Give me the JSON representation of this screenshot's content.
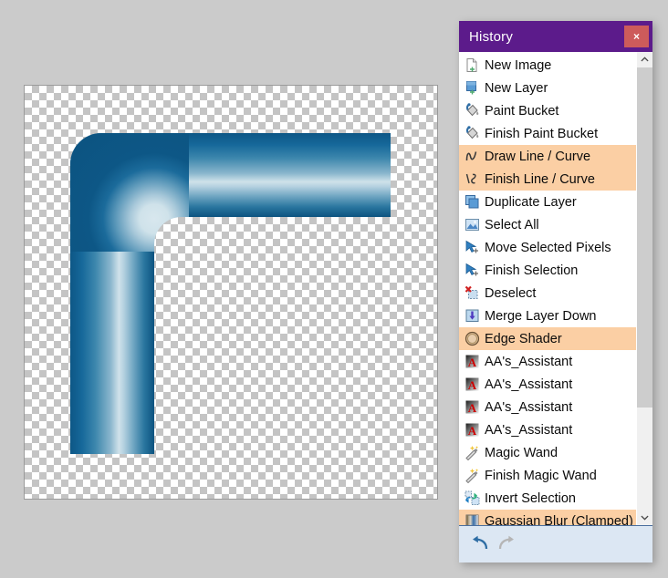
{
  "window": {
    "title": "History",
    "close_label": "×"
  },
  "history": {
    "items": [
      {
        "label": "New Image",
        "icon": "new-image-icon",
        "selected": false
      },
      {
        "label": "New Layer",
        "icon": "new-layer-icon",
        "selected": false
      },
      {
        "label": "Paint Bucket",
        "icon": "paint-bucket-icon",
        "selected": false
      },
      {
        "label": "Finish Paint Bucket",
        "icon": "paint-bucket-icon",
        "selected": false
      },
      {
        "label": "Draw Line / Curve",
        "icon": "line-curve-icon",
        "selected": true
      },
      {
        "label": "Finish Line / Curve",
        "icon": "finish-line-curve-icon",
        "selected": true
      },
      {
        "label": "Duplicate Layer",
        "icon": "duplicate-layer-icon",
        "selected": false
      },
      {
        "label": "Select All",
        "icon": "select-all-icon",
        "selected": false
      },
      {
        "label": "Move Selected Pixels",
        "icon": "move-selection-icon",
        "selected": false
      },
      {
        "label": "Finish Selection",
        "icon": "move-selection-icon",
        "selected": false
      },
      {
        "label": "Deselect",
        "icon": "deselect-icon",
        "selected": false
      },
      {
        "label": "Merge Layer Down",
        "icon": "merge-layer-down-icon",
        "selected": false
      },
      {
        "label": "Edge Shader",
        "icon": "edge-shader-icon",
        "selected": true
      },
      {
        "label": "AA's_Assistant",
        "icon": "aa-assistant-icon",
        "selected": false
      },
      {
        "label": "AA's_Assistant",
        "icon": "aa-assistant-icon",
        "selected": false
      },
      {
        "label": "AA's_Assistant",
        "icon": "aa-assistant-icon",
        "selected": false
      },
      {
        "label": "AA's_Assistant",
        "icon": "aa-assistant-icon",
        "selected": false
      },
      {
        "label": "Magic Wand",
        "icon": "magic-wand-icon",
        "selected": false
      },
      {
        "label": "Finish Magic Wand",
        "icon": "magic-wand-icon",
        "selected": false
      },
      {
        "label": "Invert Selection",
        "icon": "invert-selection-icon",
        "selected": false
      },
      {
        "label": "Gaussian Blur (Clamped)",
        "icon": "gaussian-blur-icon",
        "selected": true
      }
    ]
  },
  "scrollbar": {
    "up_icon": "chevron-up-icon",
    "down_icon": "chevron-down-icon",
    "thumb_position_percent": 0
  },
  "footer": {
    "undo_icon": "undo-arrow-icon",
    "redo_icon": "redo-arrow-icon",
    "undo_enabled": true,
    "redo_enabled": false
  },
  "canvas": {
    "transparency_checker": true,
    "shape": "blue-glossy-elbow-pipe"
  },
  "colors": {
    "title_bar": "#5c1b8b",
    "close_button": "#cd5b5b",
    "selection_highlight": "#fbcfa4",
    "footer_background": "#dce7f3",
    "app_background": "#cbcbcb",
    "pipe_dark": "#0d5786",
    "pipe_light": "#cfe2ea"
  }
}
